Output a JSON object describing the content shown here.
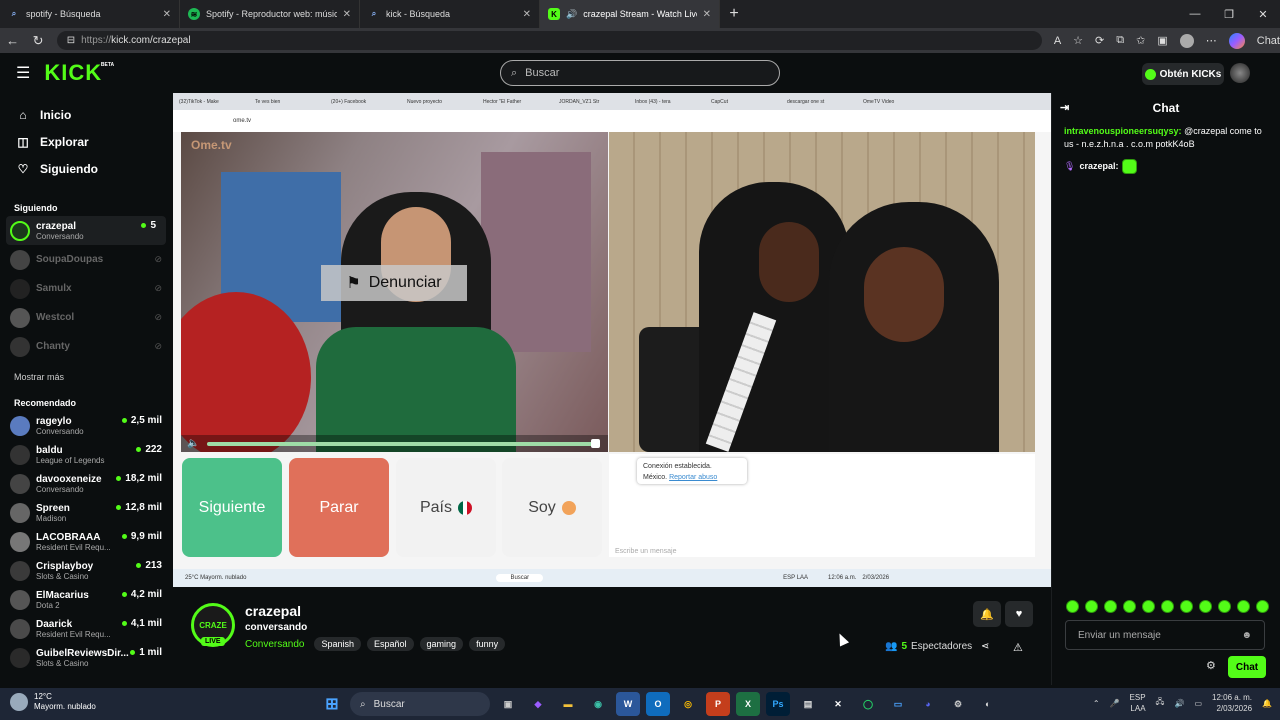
{
  "browser": {
    "tabs": [
      {
        "title": "spotify - Búsqueda",
        "icon": "search-icon"
      },
      {
        "title": "Spotify - Reproductor web: músic",
        "icon": "spotify-icon"
      },
      {
        "title": "kick - Búsqueda",
        "icon": "search-icon"
      },
      {
        "title": "crazepal Stream - Watch Live",
        "icon": "kick-icon"
      }
    ],
    "url_prefix": "https://",
    "url_host": "kick.com/crazepal"
  },
  "kick": {
    "logo": "KICK",
    "beta": "BETA",
    "search_placeholder": "Buscar",
    "get_kicks": "Obtén KICKs"
  },
  "sidebar": {
    "nav": [
      {
        "label": "Inicio",
        "icon": "home-icon"
      },
      {
        "label": "Explorar",
        "icon": "compass-icon"
      },
      {
        "label": "Siguiendo",
        "icon": "heart-icon"
      }
    ],
    "following_title": "Siguiendo",
    "following": [
      {
        "name": "crazepal",
        "sub": "Conversando",
        "count": "5",
        "live": true
      },
      {
        "name": "SoupaDoupas",
        "live": false
      },
      {
        "name": "Samulx",
        "live": false
      },
      {
        "name": "Westcol",
        "live": false
      },
      {
        "name": "Chanty",
        "live": false
      }
    ],
    "show_more": "Mostrar más",
    "recommended_title": "Recomendado",
    "recommended": [
      {
        "name": "rageylo",
        "sub": "Conversando",
        "count": "2,5 mil"
      },
      {
        "name": "baldu",
        "sub": "League of Legends",
        "count": "222"
      },
      {
        "name": "davooxeneize",
        "sub": "Conversando",
        "count": "18,2 mil"
      },
      {
        "name": "Spreen",
        "sub": "Madison",
        "count": "12,8 mil"
      },
      {
        "name": "LACOBRAAA",
        "sub": "Resident Evil Requ...",
        "count": "9,9 mil"
      },
      {
        "name": "Crisplayboy",
        "sub": "Slots & Casino",
        "count": "213"
      },
      {
        "name": "ElMacarius",
        "sub": "Dota 2",
        "count": "4,2 mil"
      },
      {
        "name": "Daarick",
        "sub": "Resident Evil Requ...",
        "count": "4,1 mil"
      },
      {
        "name": "GuibelReviewsDir...",
        "sub": "Slots & Casino",
        "count": "1 mil"
      }
    ]
  },
  "stream": {
    "inner_tabs": [
      "(32)TikTok - Make",
      "Te ves bien",
      "(20+) Facebook",
      "Nuevo proyecto",
      "Hector \"El Father",
      "JORDAN_VZ1 Str",
      "Inbox (43) - tera",
      "CapCut",
      "descargar one st",
      "OmeTV Video"
    ],
    "inner_url": "ome.tv",
    "ome_logo": "Ome.tv",
    "report": "Denunciar",
    "btn_next": "Siguiente",
    "btn_stop": "Parar",
    "btn_country": "País",
    "btn_me": "Soy",
    "conn_text": "Conexión establecida.",
    "conn_country": "México.",
    "conn_report": "Reportar abuso",
    "chat_placeholder": "Escribe un mensaje",
    "inner_weather": "25°C Mayorm. nublado",
    "inner_search": "Buscar",
    "inner_time": "12:06 a.m.",
    "inner_date": "2/03/2026",
    "inner_lang": "ESP LAA"
  },
  "channel": {
    "name": "crazepal",
    "title": "conversando",
    "category": "Conversando",
    "tags": [
      "Spanish",
      "Español",
      "gaming",
      "funny"
    ],
    "live_badge": "LIVE",
    "avatar_text": "CRAZE",
    "viewers_count": "5",
    "viewers_label": "Espectadores"
  },
  "chat": {
    "title": "Chat",
    "messages": [
      {
        "user": "intravenouspioneersuqysy:",
        "text": "@crazepal come to us - n.e.z.h.n.a . c.o.m potkK4oB"
      },
      {
        "user": "crazepal:",
        "text": ""
      }
    ],
    "input_placeholder": "Enviar un mensaje",
    "send_label": "Chat"
  },
  "taskbar": {
    "temp": "12°C",
    "weather": "Mayorm. nublado",
    "search": "Buscar",
    "lang1": "ESP",
    "lang2": "LAA",
    "time": "12:06 a. m.",
    "date": "2/03/2026"
  }
}
